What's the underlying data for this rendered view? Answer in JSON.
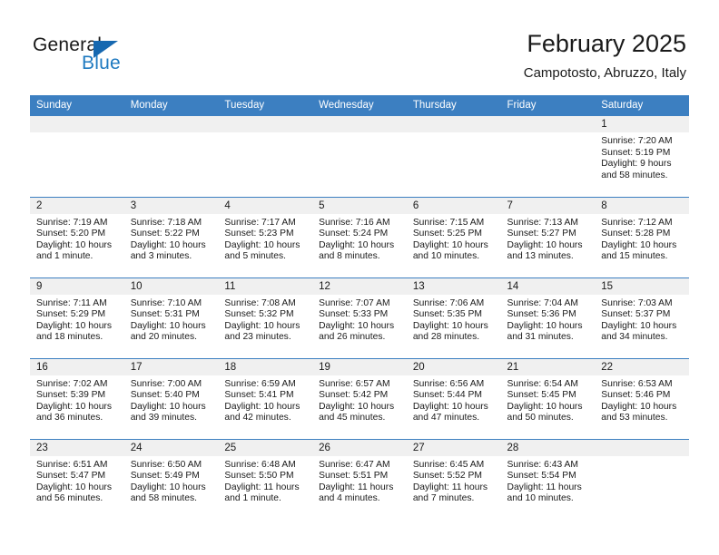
{
  "brand": {
    "name_part1": "General",
    "name_part2": "Blue",
    "triangle_icon": "blue-triangle-logo-mark",
    "accent_color": "#1f7ac0"
  },
  "header": {
    "month_title": "February 2025",
    "location": "Campotosto, Abruzzo, Italy"
  },
  "theme": {
    "header_blue": "#3c7fc1",
    "date_band_gray": "#f0f0f0",
    "text_color": "#1a1a1a"
  },
  "calendar": {
    "weekday_headers": [
      "Sunday",
      "Monday",
      "Tuesday",
      "Wednesday",
      "Thursday",
      "Friday",
      "Saturday"
    ],
    "weeks": [
      [
        {
          "date": "",
          "sunrise": "",
          "sunset": "",
          "daylight_line1": "",
          "daylight_line2": ""
        },
        {
          "date": "",
          "sunrise": "",
          "sunset": "",
          "daylight_line1": "",
          "daylight_line2": ""
        },
        {
          "date": "",
          "sunrise": "",
          "sunset": "",
          "daylight_line1": "",
          "daylight_line2": ""
        },
        {
          "date": "",
          "sunrise": "",
          "sunset": "",
          "daylight_line1": "",
          "daylight_line2": ""
        },
        {
          "date": "",
          "sunrise": "",
          "sunset": "",
          "daylight_line1": "",
          "daylight_line2": ""
        },
        {
          "date": "",
          "sunrise": "",
          "sunset": "",
          "daylight_line1": "",
          "daylight_line2": ""
        },
        {
          "date": "1",
          "sunrise": "Sunrise: 7:20 AM",
          "sunset": "Sunset: 5:19 PM",
          "daylight_line1": "Daylight: 9 hours",
          "daylight_line2": "and 58 minutes."
        }
      ],
      [
        {
          "date": "2",
          "sunrise": "Sunrise: 7:19 AM",
          "sunset": "Sunset: 5:20 PM",
          "daylight_line1": "Daylight: 10 hours",
          "daylight_line2": "and 1 minute."
        },
        {
          "date": "3",
          "sunrise": "Sunrise: 7:18 AM",
          "sunset": "Sunset: 5:22 PM",
          "daylight_line1": "Daylight: 10 hours",
          "daylight_line2": "and 3 minutes."
        },
        {
          "date": "4",
          "sunrise": "Sunrise: 7:17 AM",
          "sunset": "Sunset: 5:23 PM",
          "daylight_line1": "Daylight: 10 hours",
          "daylight_line2": "and 5 minutes."
        },
        {
          "date": "5",
          "sunrise": "Sunrise: 7:16 AM",
          "sunset": "Sunset: 5:24 PM",
          "daylight_line1": "Daylight: 10 hours",
          "daylight_line2": "and 8 minutes."
        },
        {
          "date": "6",
          "sunrise": "Sunrise: 7:15 AM",
          "sunset": "Sunset: 5:25 PM",
          "daylight_line1": "Daylight: 10 hours",
          "daylight_line2": "and 10 minutes."
        },
        {
          "date": "7",
          "sunrise": "Sunrise: 7:13 AM",
          "sunset": "Sunset: 5:27 PM",
          "daylight_line1": "Daylight: 10 hours",
          "daylight_line2": "and 13 minutes."
        },
        {
          "date": "8",
          "sunrise": "Sunrise: 7:12 AM",
          "sunset": "Sunset: 5:28 PM",
          "daylight_line1": "Daylight: 10 hours",
          "daylight_line2": "and 15 minutes."
        }
      ],
      [
        {
          "date": "9",
          "sunrise": "Sunrise: 7:11 AM",
          "sunset": "Sunset: 5:29 PM",
          "daylight_line1": "Daylight: 10 hours",
          "daylight_line2": "and 18 minutes."
        },
        {
          "date": "10",
          "sunrise": "Sunrise: 7:10 AM",
          "sunset": "Sunset: 5:31 PM",
          "daylight_line1": "Daylight: 10 hours",
          "daylight_line2": "and 20 minutes."
        },
        {
          "date": "11",
          "sunrise": "Sunrise: 7:08 AM",
          "sunset": "Sunset: 5:32 PM",
          "daylight_line1": "Daylight: 10 hours",
          "daylight_line2": "and 23 minutes."
        },
        {
          "date": "12",
          "sunrise": "Sunrise: 7:07 AM",
          "sunset": "Sunset: 5:33 PM",
          "daylight_line1": "Daylight: 10 hours",
          "daylight_line2": "and 26 minutes."
        },
        {
          "date": "13",
          "sunrise": "Sunrise: 7:06 AM",
          "sunset": "Sunset: 5:35 PM",
          "daylight_line1": "Daylight: 10 hours",
          "daylight_line2": "and 28 minutes."
        },
        {
          "date": "14",
          "sunrise": "Sunrise: 7:04 AM",
          "sunset": "Sunset: 5:36 PM",
          "daylight_line1": "Daylight: 10 hours",
          "daylight_line2": "and 31 minutes."
        },
        {
          "date": "15",
          "sunrise": "Sunrise: 7:03 AM",
          "sunset": "Sunset: 5:37 PM",
          "daylight_line1": "Daylight: 10 hours",
          "daylight_line2": "and 34 minutes."
        }
      ],
      [
        {
          "date": "16",
          "sunrise": "Sunrise: 7:02 AM",
          "sunset": "Sunset: 5:39 PM",
          "daylight_line1": "Daylight: 10 hours",
          "daylight_line2": "and 36 minutes."
        },
        {
          "date": "17",
          "sunrise": "Sunrise: 7:00 AM",
          "sunset": "Sunset: 5:40 PM",
          "daylight_line1": "Daylight: 10 hours",
          "daylight_line2": "and 39 minutes."
        },
        {
          "date": "18",
          "sunrise": "Sunrise: 6:59 AM",
          "sunset": "Sunset: 5:41 PM",
          "daylight_line1": "Daylight: 10 hours",
          "daylight_line2": "and 42 minutes."
        },
        {
          "date": "19",
          "sunrise": "Sunrise: 6:57 AM",
          "sunset": "Sunset: 5:42 PM",
          "daylight_line1": "Daylight: 10 hours",
          "daylight_line2": "and 45 minutes."
        },
        {
          "date": "20",
          "sunrise": "Sunrise: 6:56 AM",
          "sunset": "Sunset: 5:44 PM",
          "daylight_line1": "Daylight: 10 hours",
          "daylight_line2": "and 47 minutes."
        },
        {
          "date": "21",
          "sunrise": "Sunrise: 6:54 AM",
          "sunset": "Sunset: 5:45 PM",
          "daylight_line1": "Daylight: 10 hours",
          "daylight_line2": "and 50 minutes."
        },
        {
          "date": "22",
          "sunrise": "Sunrise: 6:53 AM",
          "sunset": "Sunset: 5:46 PM",
          "daylight_line1": "Daylight: 10 hours",
          "daylight_line2": "and 53 minutes."
        }
      ],
      [
        {
          "date": "23",
          "sunrise": "Sunrise: 6:51 AM",
          "sunset": "Sunset: 5:47 PM",
          "daylight_line1": "Daylight: 10 hours",
          "daylight_line2": "and 56 minutes."
        },
        {
          "date": "24",
          "sunrise": "Sunrise: 6:50 AM",
          "sunset": "Sunset: 5:49 PM",
          "daylight_line1": "Daylight: 10 hours",
          "daylight_line2": "and 58 minutes."
        },
        {
          "date": "25",
          "sunrise": "Sunrise: 6:48 AM",
          "sunset": "Sunset: 5:50 PM",
          "daylight_line1": "Daylight: 11 hours",
          "daylight_line2": "and 1 minute."
        },
        {
          "date": "26",
          "sunrise": "Sunrise: 6:47 AM",
          "sunset": "Sunset: 5:51 PM",
          "daylight_line1": "Daylight: 11 hours",
          "daylight_line2": "and 4 minutes."
        },
        {
          "date": "27",
          "sunrise": "Sunrise: 6:45 AM",
          "sunset": "Sunset: 5:52 PM",
          "daylight_line1": "Daylight: 11 hours",
          "daylight_line2": "and 7 minutes."
        },
        {
          "date": "28",
          "sunrise": "Sunrise: 6:43 AM",
          "sunset": "Sunset: 5:54 PM",
          "daylight_line1": "Daylight: 11 hours",
          "daylight_line2": "and 10 minutes."
        },
        {
          "date": "",
          "sunrise": "",
          "sunset": "",
          "daylight_line1": "",
          "daylight_line2": ""
        }
      ]
    ]
  }
}
